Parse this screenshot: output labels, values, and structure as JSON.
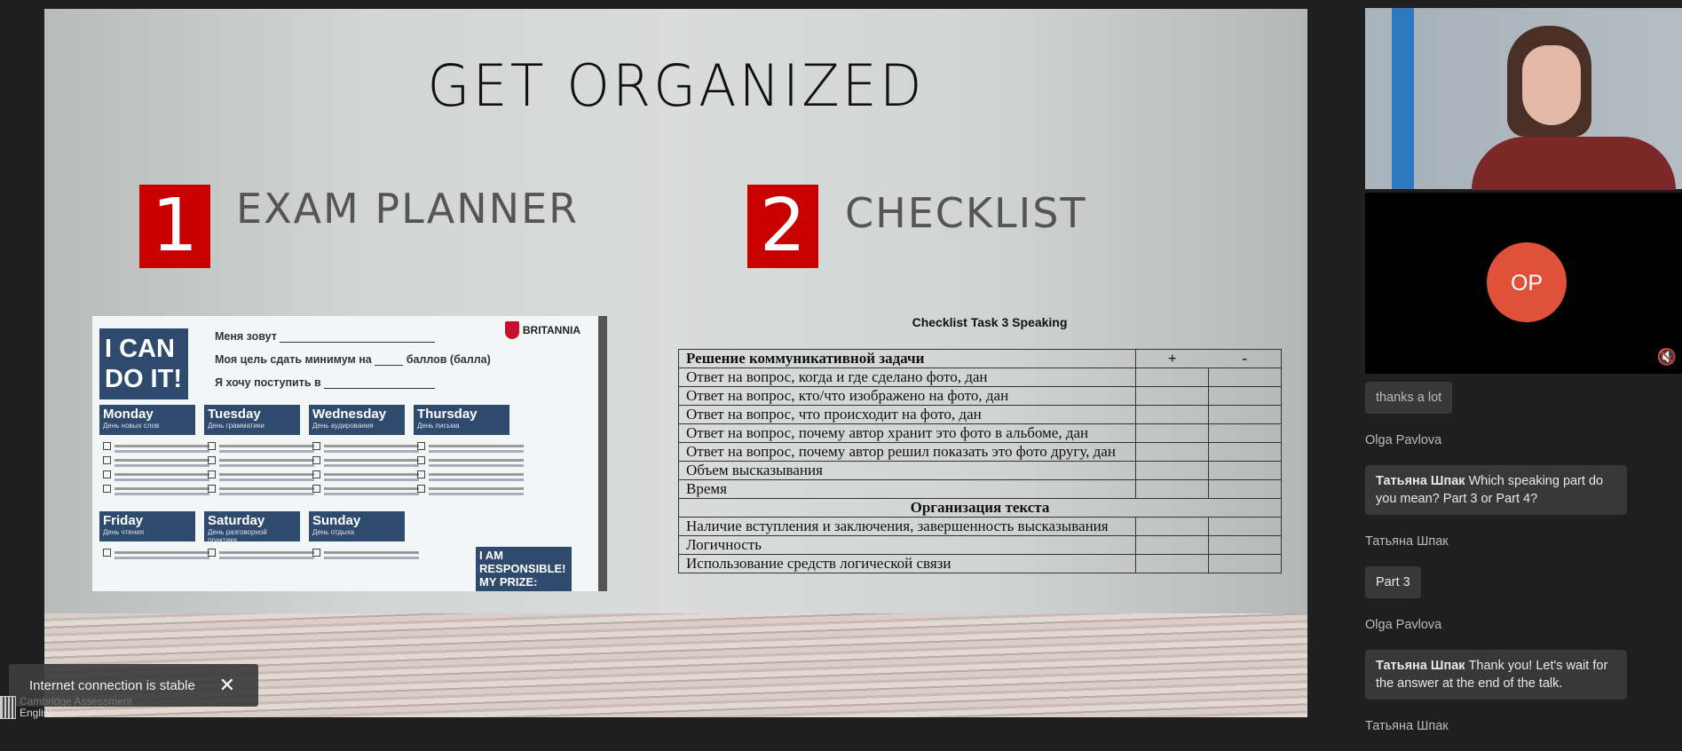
{
  "slide": {
    "title": "GET ORGANIZED",
    "section1": {
      "number": "1",
      "label": "EXAM PLANNER"
    },
    "section2": {
      "number": "2",
      "label": "CHECKLIST"
    },
    "planner": {
      "headline": "I CAN DO IT!",
      "brand": "BRITANNIA",
      "line1": "Меня зовут",
      "line2": "Моя цель сдать минимум на",
      "line2_suffix": "баллов (балла)",
      "line3": "Я хочу  поступить в",
      "days": [
        {
          "name": "Monday",
          "sub": "День новых слов"
        },
        {
          "name": "Tuesday",
          "sub": "День грамматики"
        },
        {
          "name": "Wednesday",
          "sub": "День аудирования"
        },
        {
          "name": "Thursday",
          "sub": "День письма"
        },
        {
          "name": "Friday",
          "sub": "День чтения"
        },
        {
          "name": "Saturday",
          "sub": "День разговорной практики"
        },
        {
          "name": "Sunday",
          "sub": "День отдыха"
        }
      ],
      "prize": "I AM RESPONSIBLE! MY PRIZE:"
    },
    "checklist": {
      "title": "Checklist Task 3 Speaking",
      "header": "Решение коммуникативной задачи",
      "col_plus": "+",
      "col_minus": "-",
      "rows1": [
        "Ответ на вопрос, когда и где сделано фото, дан",
        "Ответ на вопрос, кто/что изображено на фото, дан",
        "Ответ на вопрос, что происходит на фото, дан",
        "Ответ на вопрос, почему  автор хранит это фото в альбоме, дан",
        "Ответ на вопрос, почему  автор решил показать это фото другу, дан",
        "Объем высказывания",
        "Время"
      ],
      "section2": "Организация текста",
      "rows2": [
        "Наличие вступления и заключения, завершенность высказывания",
        "Логичность",
        "Использование средств логической связи"
      ]
    }
  },
  "toast": {
    "text": "Internet connection is stable",
    "close": "✕"
  },
  "logo": {
    "line1": "Cambridge Assessment",
    "line2": "English"
  },
  "participants": {
    "avatar_initials": "OP",
    "mute_icon": "🔇",
    "accent": "#e05139"
  },
  "chat": {
    "messages": [
      {
        "text": "thanks a lot"
      },
      {
        "sender": "Olga Pavlova",
        "mention": "Татьяна Шпак",
        "text": " Which speaking part do you mean? Part 3 or Part 4?"
      },
      {
        "sender": "Татьяна Шпак",
        "text": "Part 3"
      },
      {
        "sender": "Olga Pavlova",
        "mention": "Татьяна Шпак",
        "text": " Thank you! Let's wait for the answer at the end of the talk."
      },
      {
        "sender": "Татьяна Шпак"
      }
    ]
  }
}
